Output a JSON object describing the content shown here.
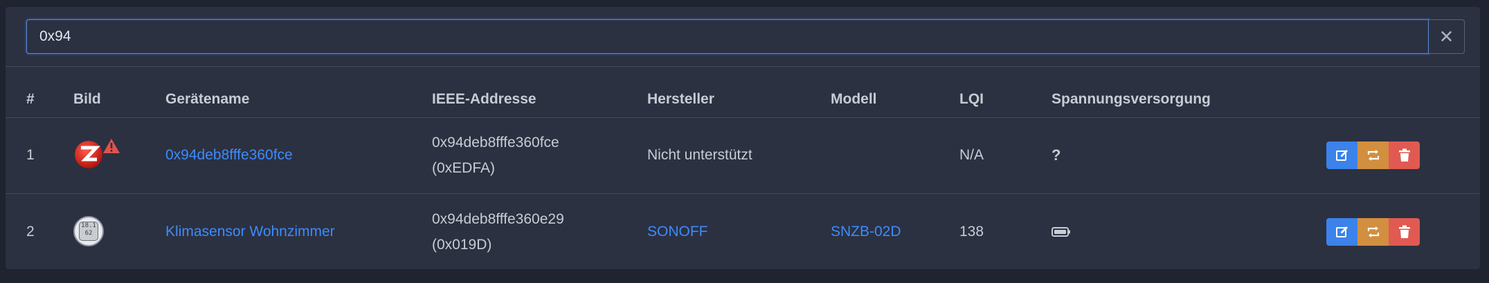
{
  "search": {
    "value": "0x94",
    "clear_label": "✕"
  },
  "table": {
    "headers": [
      "#",
      "Bild",
      "Gerätename",
      "IEEE-Addresse",
      "Hersteller",
      "Modell",
      "LQI",
      "Spannungsversorgung"
    ],
    "rows": [
      {
        "index": "1",
        "image_icon": "zigbee-logo-icon",
        "warning_icon": "warning-icon",
        "name": "0x94deb8fffe360fce",
        "ieee": "0x94deb8fffe360fce",
        "network_addr": "(0xEDFA)",
        "manufacturer": "Nicht unterstützt",
        "model": "",
        "lqi": "N/A",
        "power": "?"
      },
      {
        "index": "2",
        "image_icon": "thermometer-device-icon",
        "image_screen_top": "18.1",
        "image_screen_bottom": "62",
        "name": "Klimasensor Wohnzimmer",
        "ieee": "0x94deb8fffe360e29",
        "network_addr": "(0x019D)",
        "manufacturer": "SONOFF",
        "model": "SNZB-02D",
        "lqi": "138",
        "power_icon": "battery-icon"
      }
    ]
  },
  "colors": {
    "link": "#3d8bfd",
    "edit": "#3b82ea",
    "rename": "#d28f3f",
    "delete": "#e05a52",
    "warning": "#e0534a"
  }
}
